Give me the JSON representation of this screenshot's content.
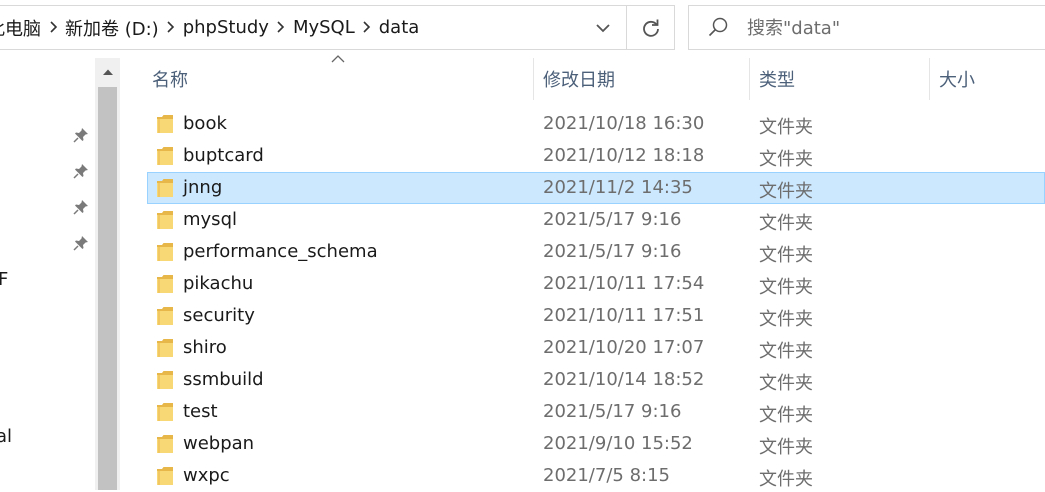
{
  "address_bar": {
    "crumbs": [
      "此电脑",
      "新加卷 (D:)",
      "phpStudy",
      "MySQL",
      "data"
    ]
  },
  "search": {
    "placeholder": "搜索\"data\""
  },
  "nav_pane": {
    "partial_labels": [
      "F",
      "al"
    ]
  },
  "columns": {
    "name": "名称",
    "date": "修改日期",
    "type": "类型",
    "size": "大小"
  },
  "files": [
    {
      "name": "book",
      "date": "2021/10/18 16:30",
      "type": "文件夹",
      "selected": false
    },
    {
      "name": "buptcard",
      "date": "2021/10/12 18:18",
      "type": "文件夹",
      "selected": false
    },
    {
      "name": "jnng",
      "date": "2021/11/2 14:35",
      "type": "文件夹",
      "selected": true
    },
    {
      "name": "mysql",
      "date": "2021/5/17 9:16",
      "type": "文件夹",
      "selected": false
    },
    {
      "name": "performance_schema",
      "date": "2021/5/17 9:16",
      "type": "文件夹",
      "selected": false
    },
    {
      "name": "pikachu",
      "date": "2021/10/11 17:54",
      "type": "文件夹",
      "selected": false
    },
    {
      "name": "security",
      "date": "2021/10/11 17:51",
      "type": "文件夹",
      "selected": false
    },
    {
      "name": "shiro",
      "date": "2021/10/20 17:07",
      "type": "文件夹",
      "selected": false
    },
    {
      "name": "ssmbuild",
      "date": "2021/10/14 18:52",
      "type": "文件夹",
      "selected": false
    },
    {
      "name": "test",
      "date": "2021/5/17 9:16",
      "type": "文件夹",
      "selected": false
    },
    {
      "name": "webpan",
      "date": "2021/9/10 15:52",
      "type": "文件夹",
      "selected": false
    },
    {
      "name": "wxpc",
      "date": "2021/7/5 8:15",
      "type": "文件夹",
      "selected": false
    }
  ],
  "colors": {
    "selection_bg": "#cce8ff",
    "selection_border": "#99d1ff",
    "header_text": "#4c607a",
    "folder_yellow": "#f8d775"
  }
}
